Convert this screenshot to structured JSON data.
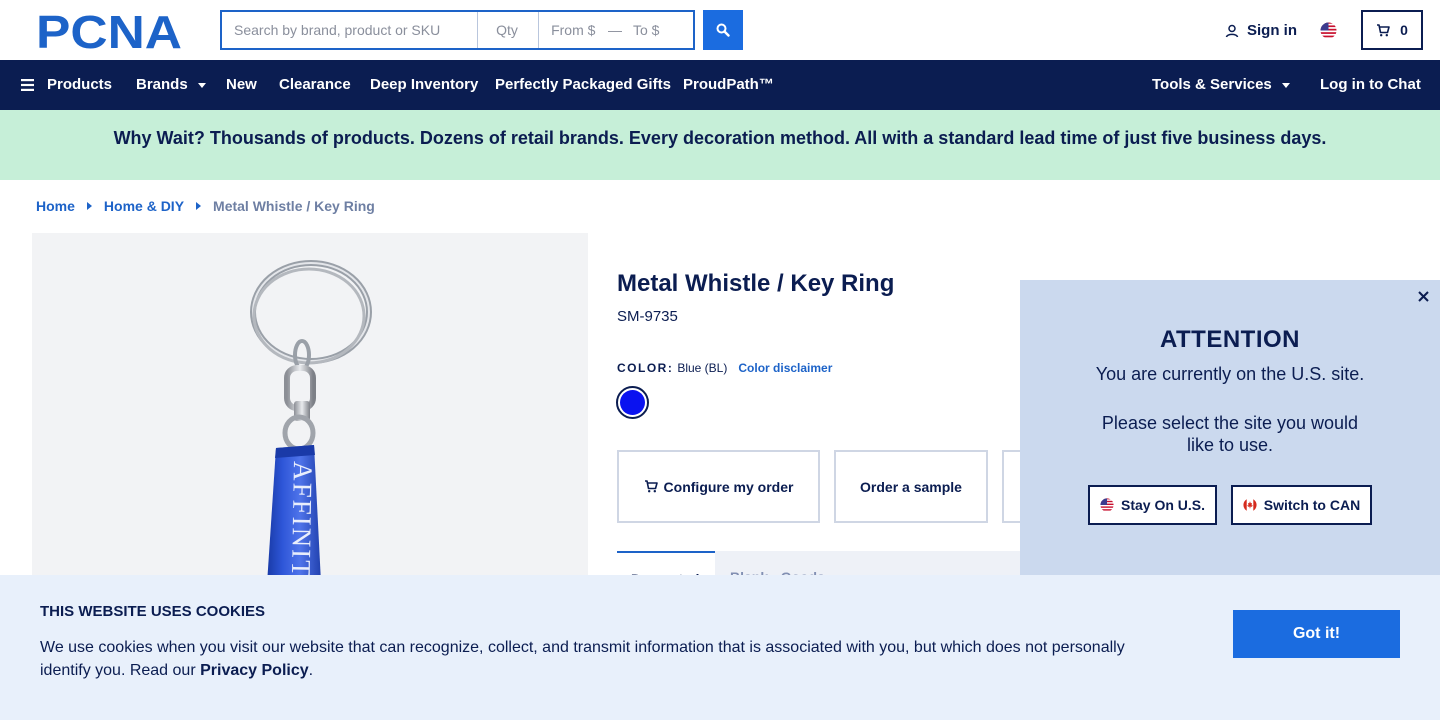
{
  "header": {
    "logo_text": "PCNA",
    "search": {
      "main_placeholder": "Search by brand, product or SKU",
      "qty_placeholder": "Qty",
      "from_placeholder": "From $",
      "to_placeholder": "To $"
    },
    "signin_label": "Sign in",
    "cart_count": "0"
  },
  "nav": {
    "items": [
      {
        "label": "Products"
      },
      {
        "label": "Brands"
      },
      {
        "label": "New"
      },
      {
        "label": "Clearance"
      },
      {
        "label": "Deep Inventory"
      },
      {
        "label": "Perfectly Packaged Gifts"
      },
      {
        "label": "ProudPath™"
      },
      {
        "label": "Tools & Services"
      },
      {
        "label": "Log in to Chat"
      }
    ]
  },
  "promo": {
    "text": "Why Wait? Thousands of products. Dozens of retail brands. Every decoration method. All with a standard lead time of just five business days."
  },
  "breadcrumb": {
    "items": [
      "Home",
      "Home & DIY",
      "Metal Whistle / Key Ring"
    ]
  },
  "product": {
    "title": "Metal Whistle / Key Ring",
    "sku": "SM-9735",
    "color_label": "COLOR:",
    "color_value": "Blue (BL)",
    "color_disclaimer": "Color disclaimer",
    "swatch_color": "#0a12f0",
    "image_imprint_text": "AFFINITY",
    "actions": {
      "configure": "Configure my order",
      "sample": "Order a sample"
    },
    "tabs": [
      "Decorated",
      "Blank - Goods"
    ]
  },
  "popup": {
    "title": "ATTENTION",
    "message1": "You are currently on the U.S. site.",
    "message2": "Please select the site you would like to use.",
    "stay_label": "Stay On U.S.",
    "switch_label": "Switch to CAN"
  },
  "cookie": {
    "title": "THIS WEBSITE USES COOKIES",
    "text": "We use cookies when you visit our website that can recognize, collect, and transmit information that is associated with you, but which does not personally identify you. Read our",
    "link_text": "Privacy Policy",
    "period": ".",
    "button": "Got it!"
  },
  "colors": {
    "navy": "#0b1d51",
    "link_blue": "#1d63c8",
    "button_blue": "#1b6ce0",
    "promo_green": "#c6efd8",
    "popup_bg": "#cbd9ee",
    "cookie_bg": "#e8f0fb"
  }
}
